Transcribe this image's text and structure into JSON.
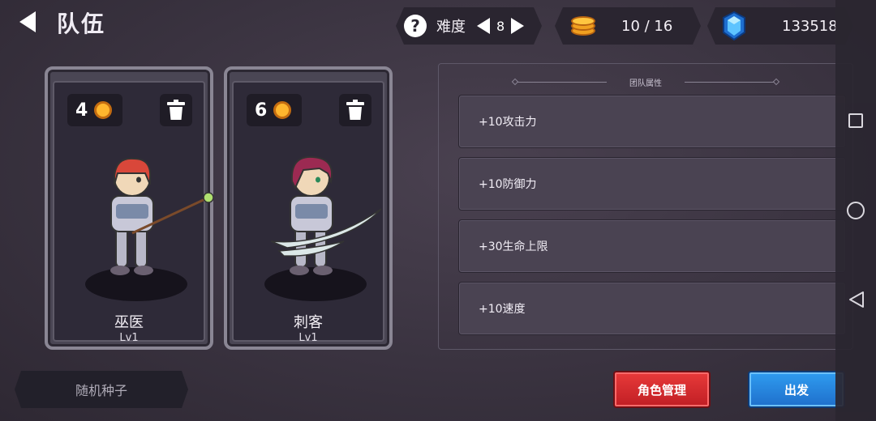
{
  "header": {
    "title": "队伍",
    "difficulty_label": "难度",
    "difficulty_value": "8",
    "coins": "10 / 16",
    "gems": "133518"
  },
  "cards": [
    {
      "cost": "4",
      "name": "巫医",
      "level": "Lv1",
      "hair_color": "#d9473a",
      "weapon": "staff"
    },
    {
      "cost": "6",
      "name": "刺客",
      "level": "Lv1",
      "hair_color": "#9c2a52",
      "weapon": "blades"
    }
  ],
  "attributes": {
    "title": "团队属性",
    "items": [
      "+10攻击力",
      "+10防御力",
      "+30生命上限",
      "+10速度"
    ]
  },
  "buttons": {
    "seed": "随机种子",
    "manage": "角色管理",
    "depart": "出发"
  },
  "colors": {
    "background": "#3a3340",
    "coin": "#ffb62e",
    "gem": "#3aa8f0",
    "button_red": "#d42a2e",
    "button_blue": "#2886e0"
  },
  "icons": [
    "back-arrow-icon",
    "help-icon",
    "coin-stack-icon",
    "gem-icon",
    "trash-icon",
    "nav-square-icon",
    "nav-circle-icon",
    "nav-back-icon"
  ]
}
